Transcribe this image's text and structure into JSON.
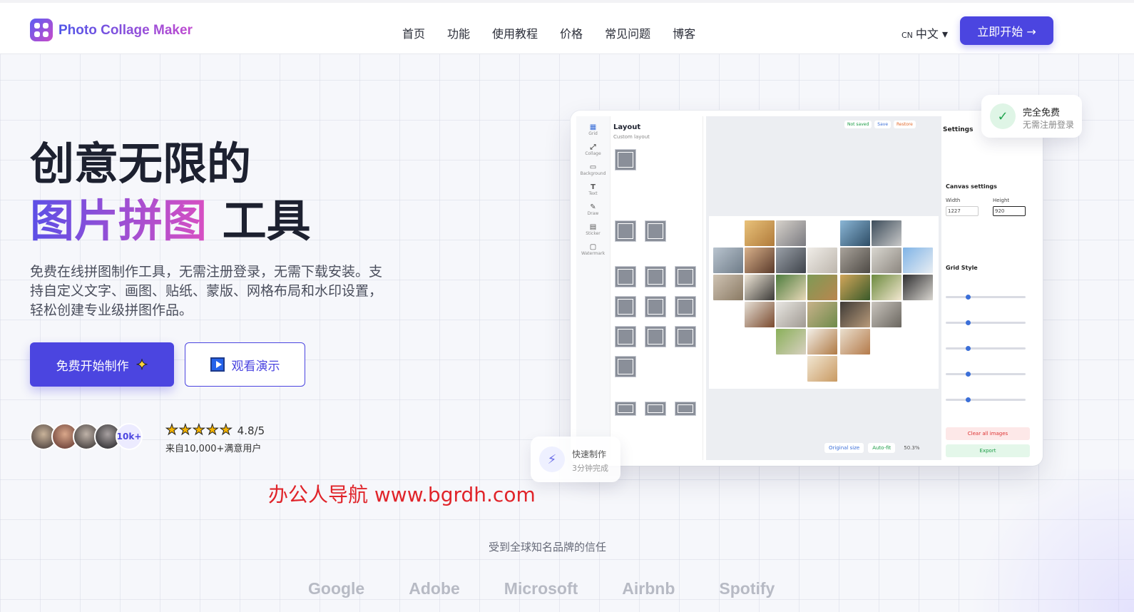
{
  "header": {
    "brand": "Photo Collage Maker",
    "nav": [
      "首页",
      "功能",
      "使用教程",
      "价格",
      "常见问题",
      "博客"
    ],
    "lang_code": "CN",
    "lang_label": "中文 ▾",
    "cta": "立即开始 →"
  },
  "hero": {
    "title_line1": "创意无限的",
    "title_highlight": "图片拼图",
    "title_rest": " 工具",
    "description": "免费在线拼图制作工具，无需注册登录，无需下载安装。支持自定义文字、画图、贴纸、蒙版、网格布局和水印设置，轻松创建专业级拼图作品。",
    "primary_button": "免费开始制作",
    "secondary_button": "观看演示",
    "avatar_more": "10k+",
    "stars": "★★★★★",
    "rating": "4.8/5",
    "rating_sub": "来自10,000+满意用户"
  },
  "badges": {
    "free_title": "完全免费",
    "free_sub": "无需注册登录",
    "fast_title": "快速制作",
    "fast_sub": "3分钟完成"
  },
  "mockup": {
    "sidebar": [
      "Grid",
      "Collage",
      "Background",
      "Text",
      "Draw",
      "Sticker",
      "Watermark"
    ],
    "layout_title": "Layout",
    "layout_sub": "Custom layout",
    "status": "Not saved",
    "save": "Save",
    "restore": "Restore",
    "settings_title": "Settings",
    "canvas_settings": "Canvas settings",
    "width_label": "Width",
    "height_label": "Height",
    "width": "1227",
    "height": "920",
    "grid_style": "Grid Style",
    "clear": "Clear all images",
    "export": "Export",
    "original_size": "Original size",
    "auto_fit": "Auto-fit",
    "zoom": "50.3%"
  },
  "watermark": "办公人导航 www.bgrdh.com",
  "trusted_text": "受到全球知名品牌的信任",
  "brands": [
    "Google",
    "Adobe",
    "Microsoft",
    "Airbnb",
    "Spotify"
  ],
  "colors": {
    "primary": "#4b45e0",
    "gradient_start": "#5b4fe6",
    "gradient_end": "#d84fc2"
  }
}
